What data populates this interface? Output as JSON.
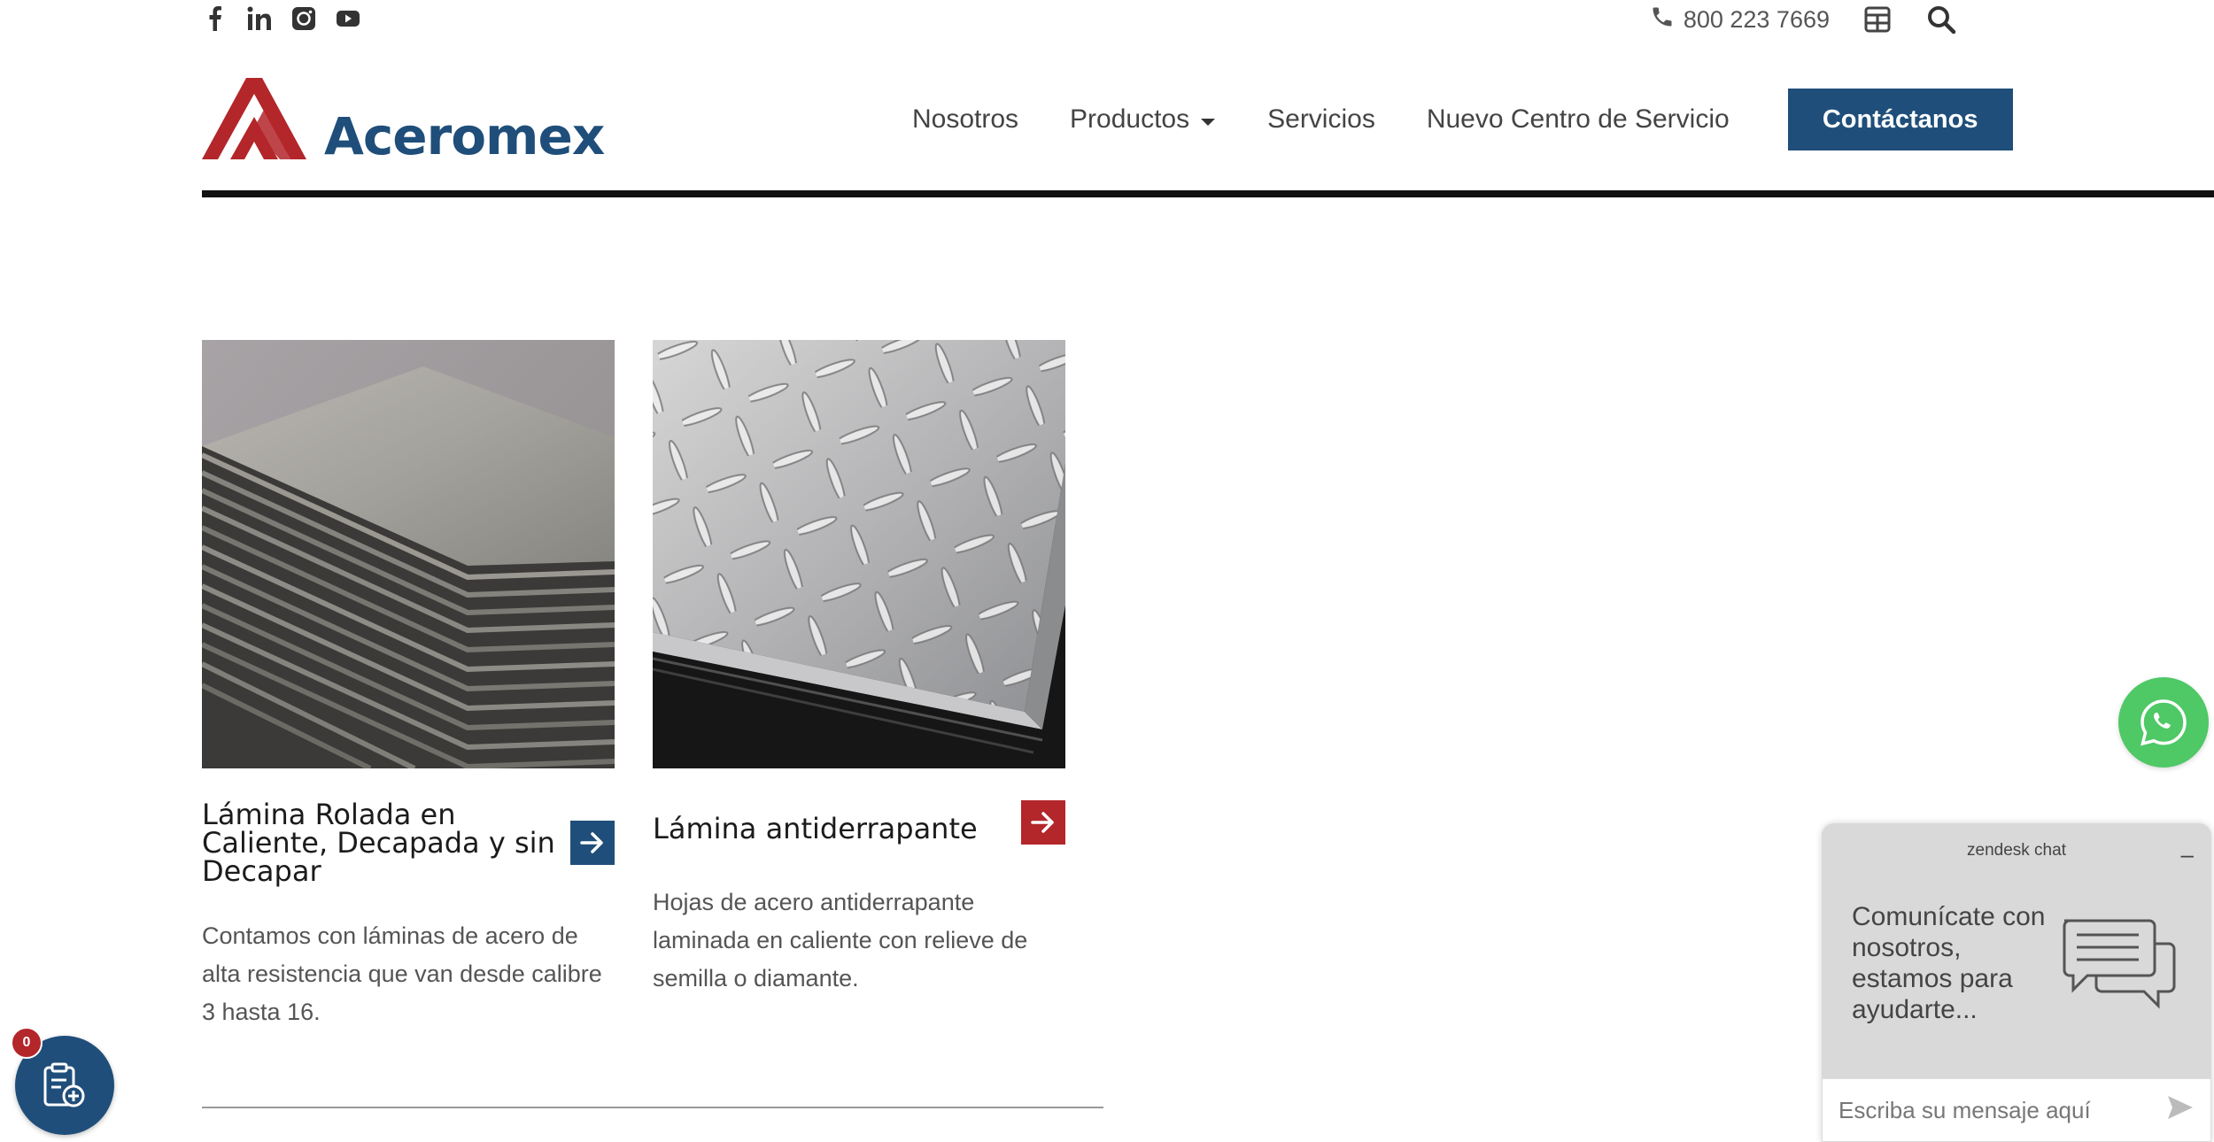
{
  "topbar": {
    "social": [
      "facebook-icon",
      "linkedin-icon",
      "instagram-icon",
      "youtube-icon"
    ],
    "phone": "800 223 7669"
  },
  "header": {
    "logo_text": "Aceromex",
    "nav": [
      {
        "label": "Nosotros"
      },
      {
        "label": "Productos"
      },
      {
        "label": "Servicios"
      },
      {
        "label": "Nuevo Centro de Servicio"
      }
    ],
    "cta": "Contáctanos"
  },
  "cards": [
    {
      "title": "Lámina Rolada en Caliente, Decapada y sin Decapar",
      "description": "Contamos con láminas de acero de alta resistencia que van desde calibre 3 hasta 16."
    },
    {
      "title": "Lámina antiderrapante",
      "description": "Hojas de acero antiderrapante laminada en caliente con relieve de semilla o diamante."
    }
  ],
  "chat": {
    "header": "zendesk chat",
    "minimize": "–",
    "message": "Comunícate con nosotros, estamos para ayudarte...",
    "input_placeholder": "Escriba su mensaje aquí"
  },
  "cart": {
    "count": "0"
  },
  "colors": {
    "brand_blue": "#1f4e7a",
    "brand_red": "#b3262a",
    "whatsapp_green": "#4fc866"
  }
}
